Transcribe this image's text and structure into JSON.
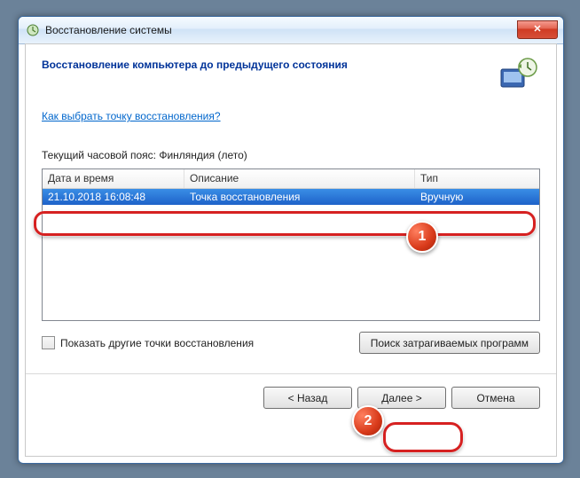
{
  "window": {
    "title": "Восстановление системы"
  },
  "heading": "Восстановление компьютера до предыдущего состояния",
  "help_link": "Как выбрать точку восстановления?",
  "timezone_label": "Текущий часовой пояс: Финляндия (лето)",
  "table": {
    "columns": {
      "c1": "Дата и время",
      "c2": "Описание",
      "c3": "Тип"
    },
    "rows": [
      {
        "c1": "21.10.2018 16:08:48",
        "c2": "Точка восстановления",
        "c3": "Вручную"
      }
    ]
  },
  "show_more_checkbox": "Показать другие точки восстановления",
  "scan_button": "Поиск затрагиваемых программ",
  "footer": {
    "back": "< Назад",
    "next": "Далее >",
    "cancel": "Отмена"
  },
  "callouts": {
    "b1": "1",
    "b2": "2"
  }
}
